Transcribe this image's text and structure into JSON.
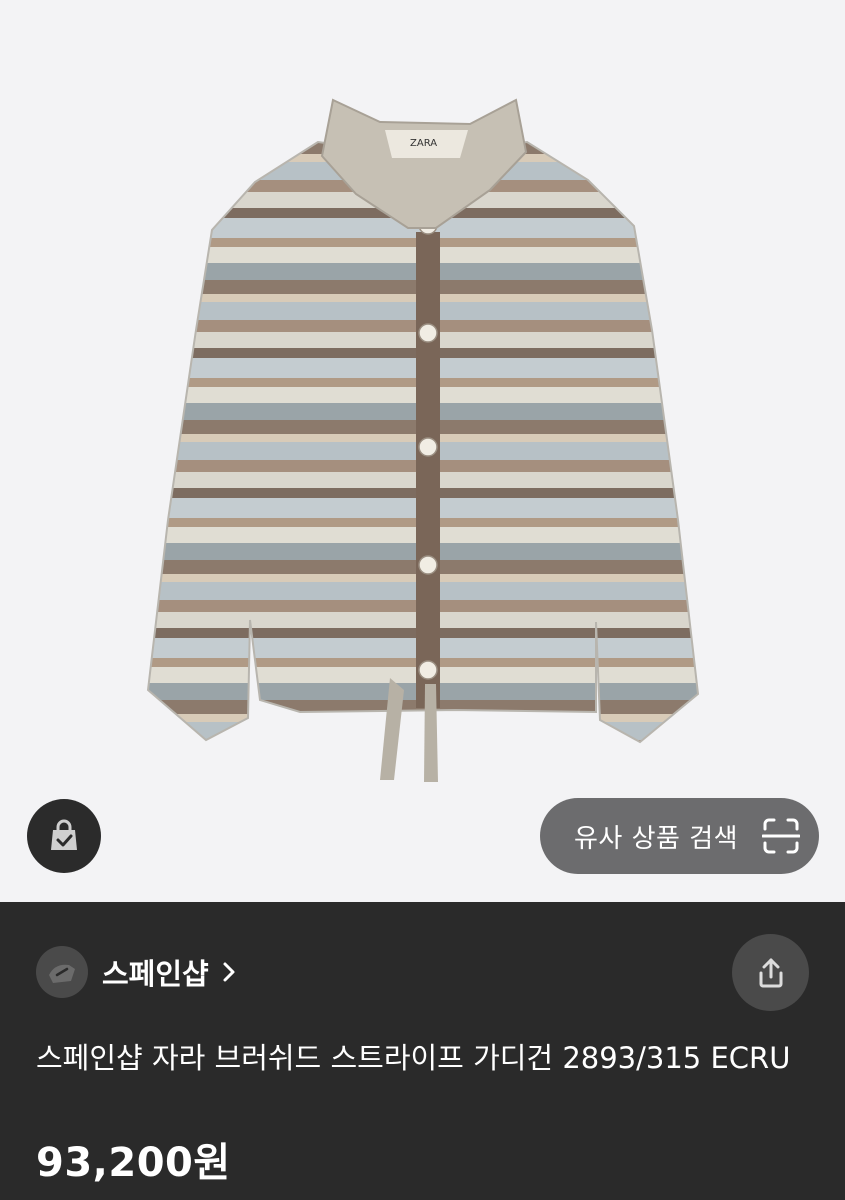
{
  "product_image": {
    "icon": "striped-cardigan-image",
    "brand_tag": "ZARA"
  },
  "actions": {
    "cart_icon": "shopping-bag-check-icon",
    "similar_search_label": "유사 상품 검색",
    "similar_search_icon": "scan-icon",
    "share_icon": "share-icon"
  },
  "seller": {
    "name": "스페인샵",
    "chevron_icon": "chevron-right-icon",
    "avatar_icon": "shop-avatar-icon"
  },
  "product": {
    "title": "스페인샵 자라 브러쉬드 스트라이프 가디건 2893/315 ECRU",
    "price": "93,200원"
  },
  "colors": {
    "background_light": "#f3f3f5",
    "panel_dark": "#2a2a2a",
    "button_gray": "#6c6c6e",
    "text_white": "#ffffff"
  }
}
